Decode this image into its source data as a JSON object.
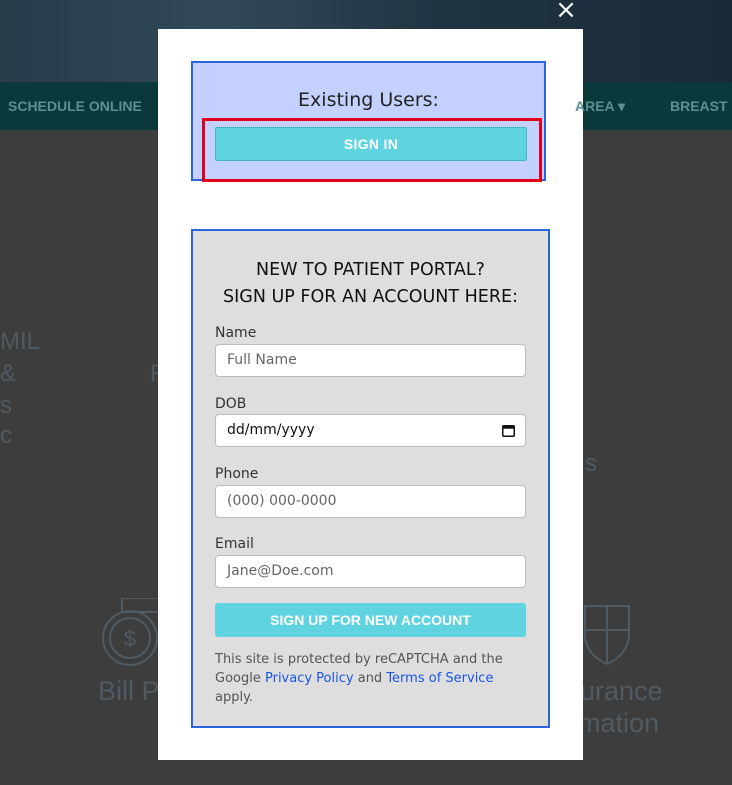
{
  "background": {
    "nav_items": [
      "SCHEDULE ONLINE",
      "AREA ▾",
      "BREAST C"
    ],
    "side_texts": [
      "MIL",
      "&",
      "s",
      "c",
      "F",
      "s"
    ],
    "bottom_texts": [
      "Bill Pa",
      "urance",
      "mation"
    ]
  },
  "close": {
    "label": "×"
  },
  "existing": {
    "title": "Existing Users:",
    "signin_label": "SIGN IN"
  },
  "signup": {
    "title_line1": "NEW TO PATIENT PORTAL?",
    "title_line2": "SIGN UP FOR AN ACCOUNT HERE:",
    "name_label": "Name",
    "name_placeholder": "Full Name",
    "dob_label": "DOB",
    "dob_value": "dd/mm/yyyy",
    "phone_label": "Phone",
    "phone_placeholder": "(000) 000-0000",
    "email_label": "Email",
    "email_placeholder": "Jane@Doe.com",
    "submit_label": "SIGN UP FOR NEW ACCOUNT",
    "recaptcha_pre": "This site is protected by reCAPTCHA and the Google ",
    "privacy_link": "Privacy Policy",
    "recaptcha_and": " and ",
    "terms_link": "Terms of Service",
    "recaptcha_post": " apply."
  },
  "colors": {
    "accent_button": "#5fd3e0",
    "existing_box_bg": "#c4d1ff",
    "border_blue": "#2b64dc",
    "highlight_red": "#e0001a",
    "link_blue": "#1a56e0"
  }
}
